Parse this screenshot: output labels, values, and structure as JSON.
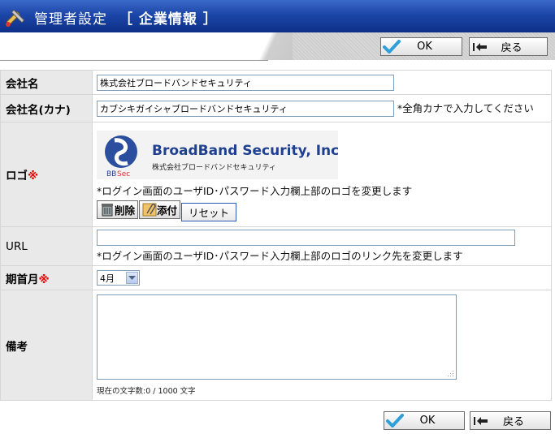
{
  "header": {
    "title": "管理者設定",
    "section": "［ 企業情報 ］",
    "icon": "tools-icon"
  },
  "toolbar": {
    "ok_label": "OK",
    "back_label": "戻る"
  },
  "form": {
    "company_name": {
      "label": "会社名",
      "value": "株式会社ブロードバンドセキュリティ"
    },
    "company_kana": {
      "label": "会社名(カナ)",
      "value": "カブシキガイシャブロードバンドセキュリティ",
      "hint": "*全角カナで入力してください"
    },
    "logo": {
      "label": "ロゴ",
      "required_mark": "※",
      "brand_name": "BroadBand Security, Inc.",
      "brand_sub": "株式会社ブロードバンドセキュリティ",
      "brand_short": "BBSec",
      "note": "*ログイン画面のユーザID･パスワード入力欄上部のロゴを変更します",
      "delete_label": "削除",
      "attach_label": "添付",
      "reset_label": "リセット"
    },
    "url": {
      "label": "URL",
      "value": "",
      "note": "*ログイン画面のユーザID･パスワード入力欄上部のロゴのリンク先を変更します"
    },
    "fiscal_month": {
      "label": "期首月",
      "required_mark": "※",
      "selected": "4月"
    },
    "remarks": {
      "label": "備考",
      "value": "",
      "counter": "現在の文字数:0 / 1000 文字"
    }
  },
  "footer": {
    "ok_label": "OK",
    "back_label": "戻る"
  },
  "colors": {
    "title_bar": "#1c46a9",
    "label_bg": "#e9e9e9",
    "required": "#ee0000",
    "brand_blue": "#1f3f8f"
  }
}
